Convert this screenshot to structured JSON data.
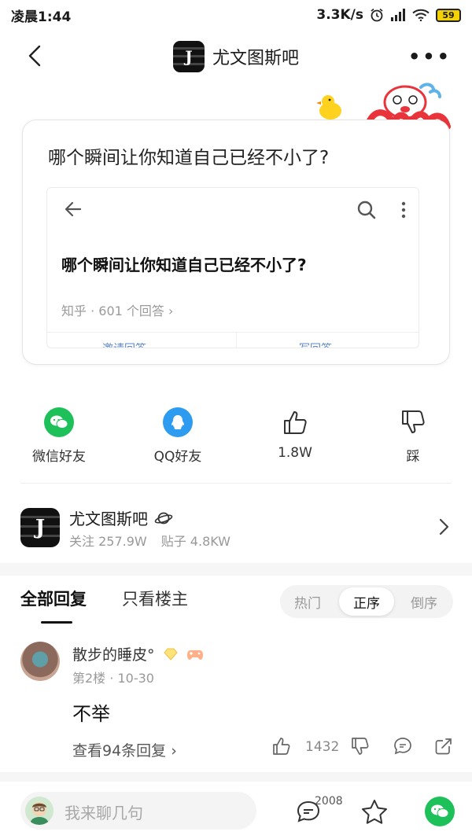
{
  "status_bar": {
    "time": "凌晨1:44",
    "network_speed": "3.3K/s",
    "battery": "59"
  },
  "nav": {
    "title": "尤文图斯吧"
  },
  "post": {
    "title": "哪个瞬间让你知道自己已经不小了?",
    "embedded": {
      "question": "哪个瞬间让你知道自己已经不小了?",
      "meta": "知乎 · 601 个回答 ›",
      "left_action": "邀请回答",
      "right_action": "写回答"
    }
  },
  "share": {
    "wechat_label": "微信好友",
    "qq_label": "QQ好友",
    "like_count": "1.8W",
    "dislike_label": "踩"
  },
  "forum": {
    "name": "尤文图斯吧",
    "followers": "关注 257.9W",
    "posts": "贴子 4.8KW"
  },
  "tabs": {
    "all_replies": "全部回复",
    "op_only": "只看楼主",
    "sort_hot": "热门",
    "sort_asc": "正序",
    "sort_desc": "倒序"
  },
  "comment": {
    "username": "散步的睡皮°",
    "floor": "第2楼",
    "date": "10-30",
    "text": "不举",
    "view_replies": "查看94条回复 ›",
    "like_count": "1432"
  },
  "bottom_bar": {
    "reply_placeholder": "我来聊几句",
    "comment_count": "2008"
  },
  "colors": {
    "wechat_green": "#1ec05a",
    "qq_blue": "#2d9bf0"
  }
}
